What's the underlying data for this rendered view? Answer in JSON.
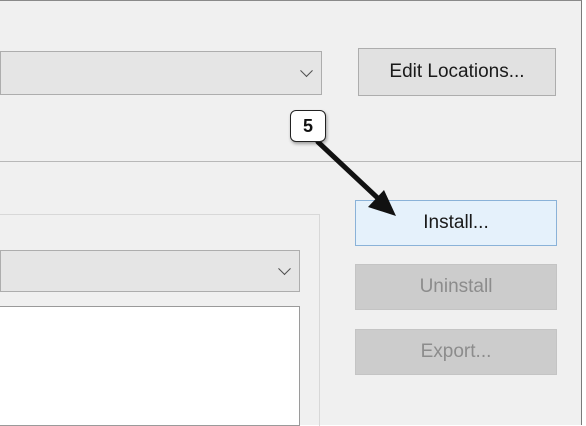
{
  "top": {
    "locations_combo_value": "",
    "edit_locations_label": "Edit Locations..."
  },
  "actions": {
    "install_label": "Install...",
    "uninstall_label": "Uninstall",
    "export_label": "Export..."
  },
  "group": {
    "filter_combo_value": ""
  },
  "annotation": {
    "step_number": "5",
    "icon": "callout-arrow-icon"
  }
}
